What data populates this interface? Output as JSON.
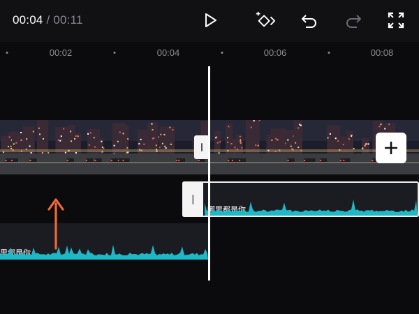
{
  "player": {
    "current_time": "00:04",
    "separator": "/",
    "total_time": "00:11"
  },
  "toolbar": {
    "icons": [
      "play-icon",
      "keyframe-icon",
      "undo-icon",
      "redo-icon",
      "fullscreen-icon"
    ]
  },
  "ruler": {
    "labels": [
      "00:02",
      "00:04",
      "00:06",
      "00:08"
    ]
  },
  "video_track": {
    "add_icon": "plus-icon"
  },
  "audio_tracks": {
    "selected_label": "哪里都是你",
    "previous_label": "里都是你"
  },
  "colors": {
    "background": "#0b0b0d",
    "waveform": "#1fb8c6",
    "annotation_arrow": "#f0683a"
  }
}
